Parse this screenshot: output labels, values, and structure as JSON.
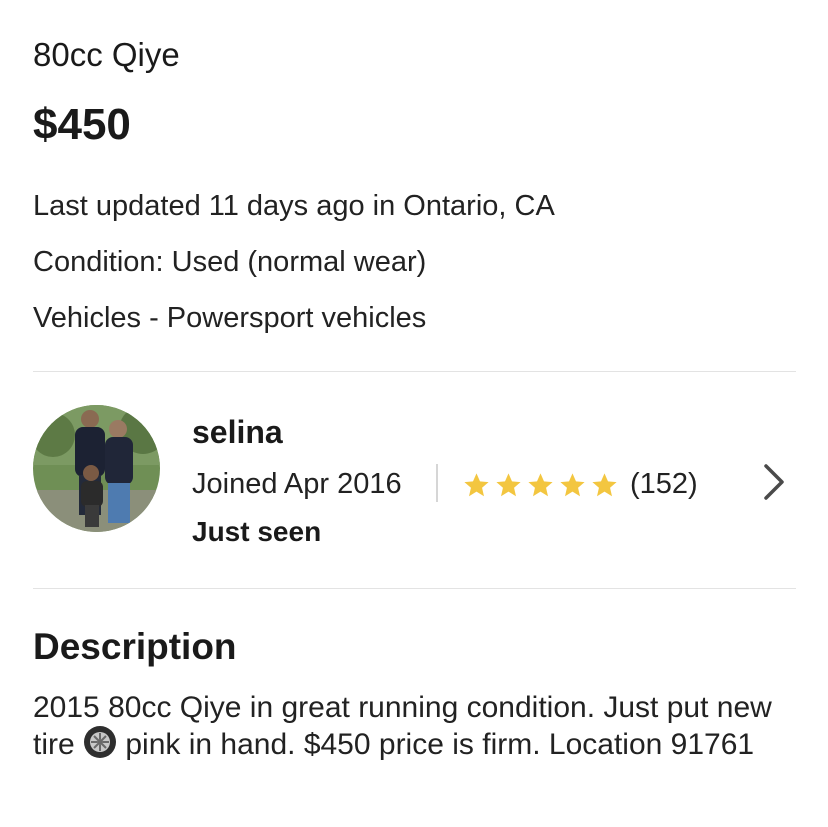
{
  "listing": {
    "title": "80cc Qiye",
    "price": "$450",
    "last_updated": "Last updated 11 days ago in Ontario, CA",
    "condition": "Condition: Used (normal wear)",
    "category": "Vehicles - Powersport vehicles"
  },
  "seller": {
    "name": "selina",
    "joined": "Joined  Apr 2016",
    "rating_stars": 5,
    "rating_count": "(152)",
    "last_seen": "Just seen",
    "star_color": "#f3c640"
  },
  "description": {
    "heading": "Description",
    "text_part1": "2015 80cc Qiye in great running condition. Just put new tire ",
    "text_part2": " pink in hand. $450 price is firm. Location 91761"
  }
}
